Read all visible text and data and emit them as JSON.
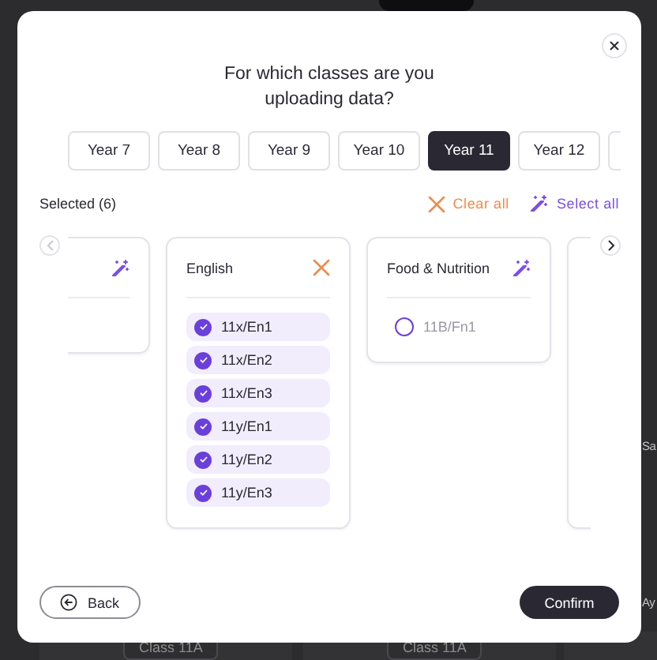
{
  "background": {
    "tags": [
      "Class 11A",
      "Class 11A"
    ],
    "side_labels": [
      "Sa",
      "Ay"
    ]
  },
  "dialog": {
    "title": "For which classes are you uploading data?",
    "years": [
      {
        "label": "Year 7",
        "selected": false
      },
      {
        "label": "Year 8",
        "selected": false
      },
      {
        "label": "Year 9",
        "selected": false
      },
      {
        "label": "Year 10",
        "selected": false
      },
      {
        "label": "Year 11",
        "selected": true
      },
      {
        "label": "Year 12",
        "selected": false
      },
      {
        "selected": false
      }
    ],
    "selected_count": "Selected (6)",
    "clear_all": "Clear all",
    "select_all": "Select all",
    "subjects": [
      {
        "kind": "select_all"
      },
      {
        "title": "English",
        "kind": "clear_all",
        "classes": [
          {
            "label": "11x/En1",
            "selected": true
          },
          {
            "label": "11x/En2",
            "selected": true
          },
          {
            "label": "11x/En3",
            "selected": true
          },
          {
            "label": "11y/En1",
            "selected": true
          },
          {
            "label": "11y/En2",
            "selected": true
          },
          {
            "label": "11y/En3",
            "selected": true
          }
        ]
      },
      {
        "title": "Food & Nutrition",
        "kind": "select_all",
        "classes": [
          {
            "label": "11B/Fn1",
            "selected": false
          }
        ]
      },
      {
        "kind": "none"
      }
    ],
    "back": "Back",
    "confirm": "Confirm"
  }
}
